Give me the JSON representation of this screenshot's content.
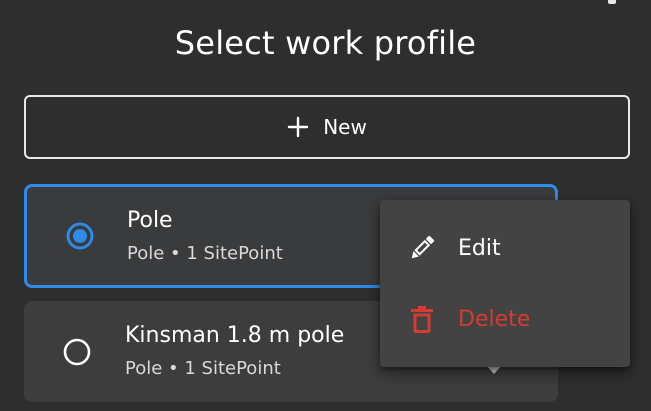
{
  "page": {
    "title": "Select work profile"
  },
  "new_button": {
    "label": "New"
  },
  "profiles": [
    {
      "name": "Pole",
      "subtitle": "Pole • 1 SitePoint",
      "selected": true
    },
    {
      "name": "Kinsman 1.8 m pole",
      "subtitle": "Pole • 1 SitePoint",
      "selected": false
    }
  ],
  "context_menu": {
    "edit_label": "Edit",
    "delete_label": "Delete"
  },
  "colors": {
    "background": "#2e2e2e",
    "accent": "#2f8be8",
    "danger": "#d33b33",
    "card": "#3d3d3d",
    "menu": "#434343"
  },
  "icons": {
    "new": "plus-icon",
    "edit": "pencil-icon",
    "delete": "trash-icon",
    "selected_radio": "radio-checked-icon",
    "unselected_radio": "radio-unchecked-icon",
    "expand": "caret-down-icon"
  }
}
